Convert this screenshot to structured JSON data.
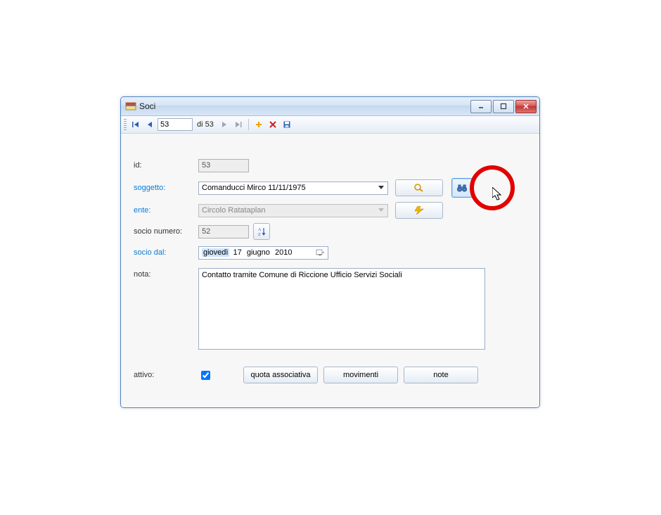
{
  "window": {
    "title": "Soci"
  },
  "nav": {
    "current": "53",
    "count_label": "di 53"
  },
  "form": {
    "labels": {
      "id": "id:",
      "soggetto": "soggetto:",
      "ente": "ente:",
      "socio_numero": "socio numero:",
      "socio_dal": "socio dal:",
      "nota": "nota:",
      "attivo": "attivo:"
    },
    "id": "53",
    "soggetto": "Comanducci Mirco 11/11/1975",
    "ente": "Circolo Ratataplan",
    "socio_numero": "52",
    "date_weekday": "giovedì",
    "date_day": "17",
    "date_month": "giugno",
    "date_year": "2010",
    "nota": "Contatto tramite Comune di Riccione Ufficio Servizi Sociali",
    "attivo": true
  },
  "buttons": {
    "quota": "quota associativa",
    "movimenti": "movimenti",
    "note": "note"
  }
}
